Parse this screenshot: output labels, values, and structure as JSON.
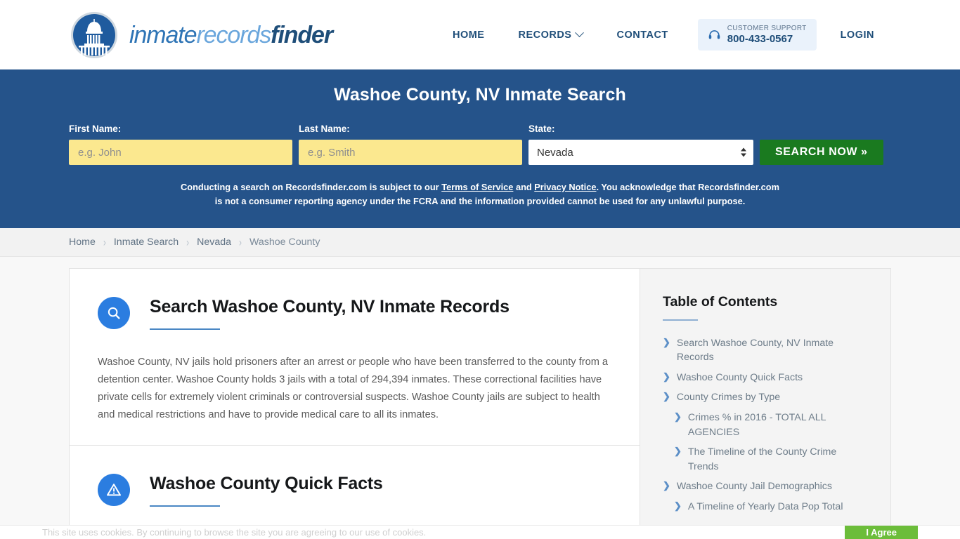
{
  "brand": {
    "word1": "inmate",
    "word2": "records",
    "word3": "finder",
    "logo_icon": "capitol-dome-icon"
  },
  "nav": {
    "items": [
      {
        "label": "HOME",
        "has_caret": false
      },
      {
        "label": "RECORDS",
        "has_caret": true
      },
      {
        "label": "CONTACT",
        "has_caret": false
      }
    ],
    "support": {
      "icon": "headset-icon",
      "label": "CUSTOMER SUPPORT",
      "phone": "800-433-0567"
    },
    "login_label": "LOGIN"
  },
  "hero": {
    "title": "Washoe County, NV Inmate Search",
    "background_color": "#25538a",
    "first_name": {
      "label": "First Name:",
      "value": "",
      "placeholder": "e.g. John"
    },
    "last_name": {
      "label": "Last Name:",
      "value": "",
      "placeholder": "e.g. Smith"
    },
    "state": {
      "label": "State:",
      "value": "Nevada",
      "options": [
        "Nevada"
      ]
    },
    "search_button": "SEARCH NOW »",
    "search_button_color": "#1a7a1f",
    "disclaimer_part1": "Conducting a search on Recordsfinder.com is subject to our ",
    "disclaimer_link1": "Terms of Service",
    "disclaimer_part2": " and ",
    "disclaimer_link2": "Privacy Notice",
    "disclaimer_part3": ". You acknowledge that Recordsfinder.com is not a consumer reporting agency under the FCRA and the information provided cannot be used for any unlawful purpose."
  },
  "breadcrumbs": {
    "separator": "›",
    "items": [
      {
        "label": "Home",
        "current": false
      },
      {
        "label": "Inmate Search",
        "current": false
      },
      {
        "label": "Nevada",
        "current": false
      },
      {
        "label": "Washoe County",
        "current": true
      }
    ]
  },
  "main": {
    "sections": [
      {
        "icon": "search-icon",
        "title": "Search Washoe County, NV Inmate Records",
        "body": "Washoe County, NV jails hold prisoners after an arrest or people who have been transferred to the county from a detention center. Washoe County holds 3 jails with a total of 294,394 inmates. These correctional facilities have private cells for extremely violent criminals or controversial suspects. Washoe County jails are subject to health and medical restrictions and have to provide medical care to all its inmates."
      },
      {
        "icon": "alert-triangle-icon",
        "title": "Washoe County Quick Facts",
        "body": ""
      }
    ]
  },
  "toc": {
    "title": "Table of Contents",
    "items": [
      {
        "label": "Search Washoe County, NV Inmate Records",
        "sub": false
      },
      {
        "label": "Washoe County Quick Facts",
        "sub": false
      },
      {
        "label": "County Crimes by Type",
        "sub": false
      },
      {
        "label": "Crimes % in 2016 - TOTAL ALL AGENCIES",
        "sub": true
      },
      {
        "label": "The Timeline of the County Crime Trends",
        "sub": true
      },
      {
        "label": "Washoe County Jail Demographics",
        "sub": false
      },
      {
        "label": "A Timeline of Yearly Data Pop Total",
        "sub": true
      }
    ]
  },
  "cookiebar": {
    "text": "This site uses cookies. By continuing to browse the site you are agreeing to our use of cookies.",
    "button": "I Agree",
    "button_color": "#6cbd3a"
  }
}
